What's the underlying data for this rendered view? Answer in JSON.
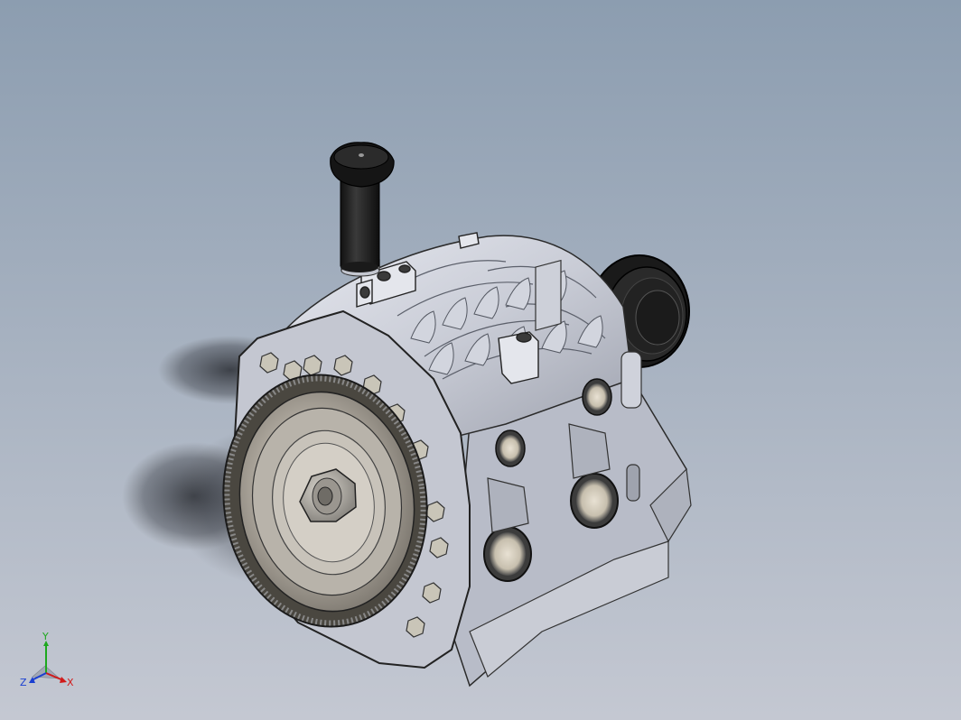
{
  "viewport": {
    "bg_top": "#8c9db0",
    "bg_bottom": "#c3c8d2"
  },
  "model": {
    "name": "rotary-engine-model",
    "icons": [
      "flywheel-icon",
      "oil-filler-cap-icon",
      "pulley-icon"
    ]
  },
  "triad": {
    "x_label": "X",
    "y_label": "Y",
    "z_label": "Z",
    "x_color": "#d11a1a",
    "y_color": "#1ea81e",
    "z_color": "#1a3fd1"
  }
}
